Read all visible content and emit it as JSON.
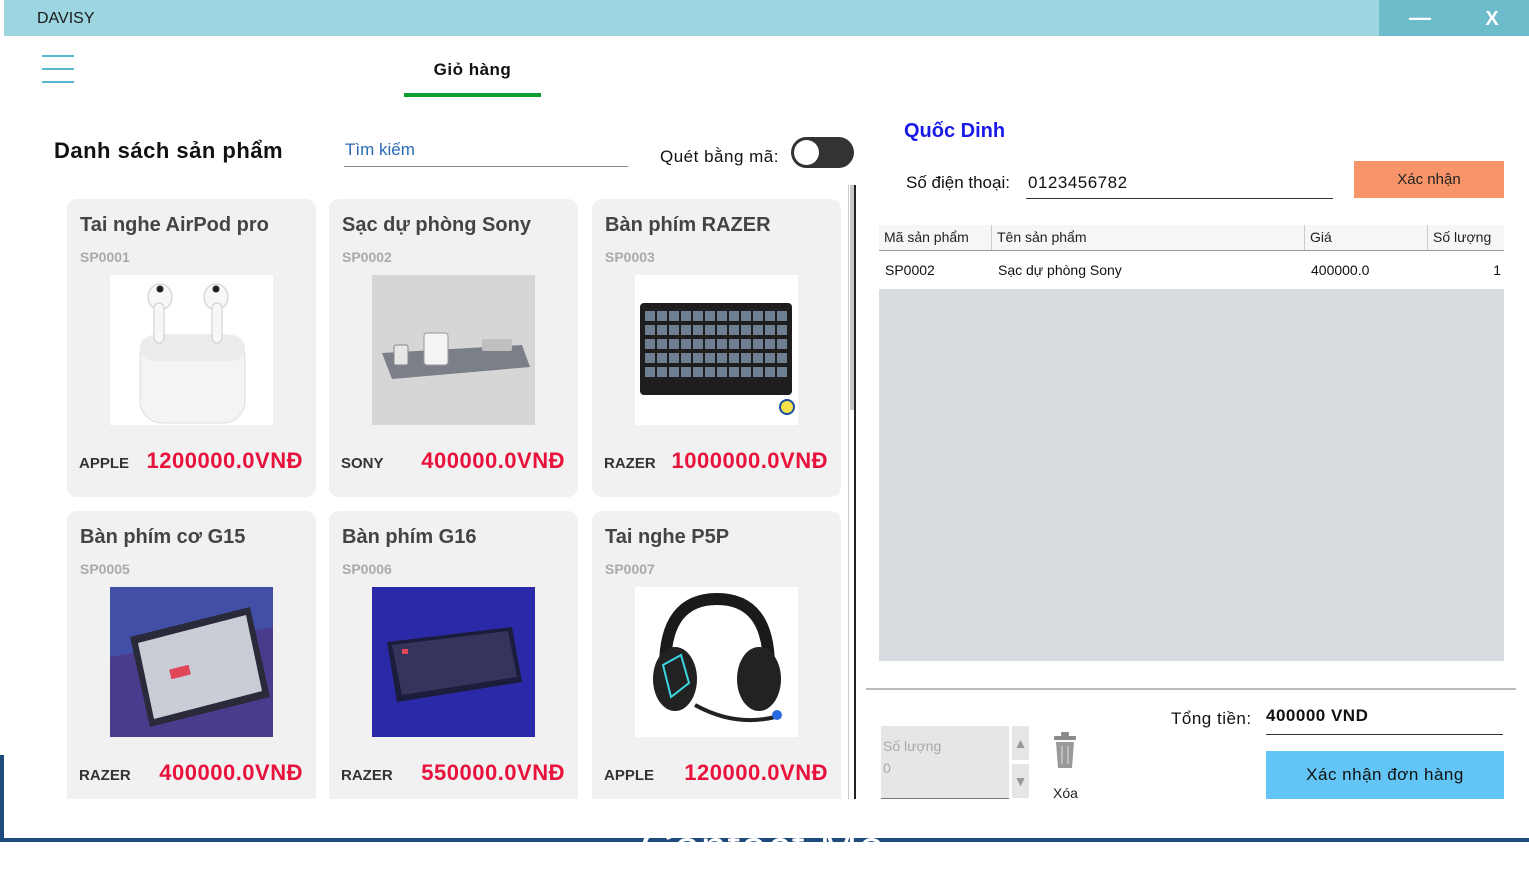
{
  "window": {
    "title": "DAVISY",
    "minimize_glyph": "—",
    "close_glyph": "X"
  },
  "nav": {
    "menu_icon": "hamburger-icon",
    "active_tab": "Giỏ hàng"
  },
  "products_panel": {
    "title": "Danh sách sản phẩm",
    "search_placeholder": "Tìm kiếm",
    "scan_label": "Quét bằng mã:",
    "scan_toggle_on": false,
    "products": [
      {
        "name": "Tai nghe AirPod pro",
        "code": "SP0001",
        "brand": "APPLE",
        "price": "1200000.0VNĐ",
        "image": "airpods-image"
      },
      {
        "name": "Sạc dự phòng Sony",
        "code": "SP0002",
        "brand": "SONY",
        "price": "400000.0VNĐ",
        "image": "power-bank-image"
      },
      {
        "name": "Bàn phím RAZER",
        "code": "SP0003",
        "brand": "RAZER",
        "price": "1000000.0VNĐ",
        "image": "keyboard-image"
      },
      {
        "name": "Bàn phím cơ G15",
        "code": "SP0005",
        "brand": "RAZER",
        "price": "400000.0VNĐ",
        "image": "mech-keyboard-image"
      },
      {
        "name": "Bàn phím G16",
        "code": "SP0006",
        "brand": "RAZER",
        "price": "550000.0VNĐ",
        "image": "keyboard-blue-image"
      },
      {
        "name": "Tai nghe P5P",
        "code": "SP0007",
        "brand": "APPLE",
        "price": "120000.0VNĐ",
        "image": "headset-image"
      }
    ]
  },
  "cart_panel": {
    "customer_name": "Quốc Dinh",
    "phone_label": "Số điện thoại:",
    "phone_value": "0123456782",
    "confirm_label": "Xác nhận",
    "table": {
      "columns": [
        "Mã sản phẩm",
        "Tên sản phẩm",
        "Giá",
        "Số lượng"
      ],
      "rows": [
        [
          "SP0002",
          "Sạc dự phòng Sony",
          "400000.0",
          "1"
        ]
      ]
    },
    "quantity_label": "Số lượng",
    "quantity_value": "0",
    "delete_label": "Xóa",
    "total_label": "Tổng tiền:",
    "total_value": "400000 VND",
    "order_button": "Xác nhận đơn hàng"
  },
  "background": {
    "contact_text": "Contact Me"
  },
  "colors": {
    "titlebar": "#9dd6e0",
    "tab_underline": "#0a9e2f",
    "price": "#e8123c",
    "customer": "#1a1ae6",
    "confirm": "#f7946a",
    "order": "#63c5f5"
  }
}
